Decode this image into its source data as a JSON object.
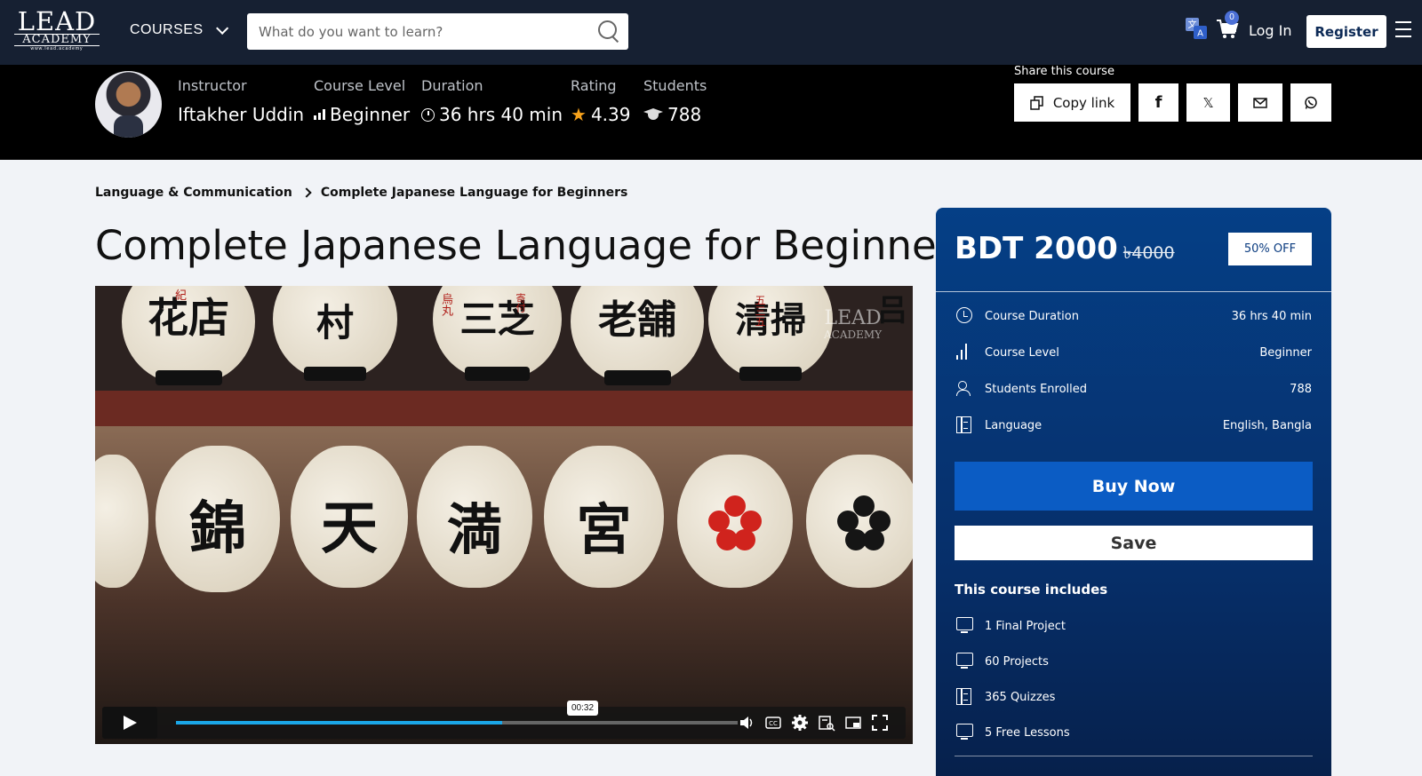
{
  "nav": {
    "logo": {
      "line1": "LEAD",
      "line2": "ACADEMY",
      "line3": "www.lead.academy"
    },
    "courses_label": "COURSES",
    "search_placeholder": "What do you want to learn?",
    "cart_count": "0",
    "login_label": "Log In",
    "register_label": "Register"
  },
  "course_meta": {
    "instructor_label": "Instructor",
    "instructor_name": "Iftakher Uddin",
    "level_label": "Course Level",
    "level_value": "Beginner",
    "duration_label": "Duration",
    "duration_value": "36 hrs 40 min",
    "rating_label": "Rating",
    "rating_value": "4.39",
    "students_label": "Students",
    "students_value": "788"
  },
  "share": {
    "title": "Share this course",
    "copy_label": "Copy link",
    "facebook": "f",
    "x": "𝕏"
  },
  "breadcrumb": {
    "category": "Language & Communication",
    "current": "Complete Japanese Language for Beginners"
  },
  "page_title": "Complete Japanese Language for Beginners",
  "video": {
    "tooltip_time": "00:32",
    "progress_fraction": 0.58,
    "watermark_line1": "LEAD",
    "watermark_line2": "ACADEMY",
    "lanterns_top": [
      "花店",
      "村",
      "三芝",
      "老舗",
      "清掃"
    ],
    "lanterns_top_extra": [
      "紀",
      "烏丸",
      "寄付",
      "五三五",
      "吕"
    ],
    "lanterns_mid": [
      "錦",
      "天",
      "満",
      "宮"
    ]
  },
  "pricing": {
    "price": "BDT 2000",
    "old_price": "৳4000",
    "discount_badge": "50% OFF"
  },
  "info": [
    {
      "icon": "clock-icon",
      "label": "Course Duration",
      "value": "36 hrs 40 min"
    },
    {
      "icon": "level-bars-icon",
      "label": "Course Level",
      "value": "Beginner"
    },
    {
      "icon": "users-icon",
      "label": "Students Enrolled",
      "value": "788"
    },
    {
      "icon": "document-icon",
      "label": "Language",
      "value": "English, Bangla"
    }
  ],
  "actions": {
    "buy_label": "Buy Now",
    "save_label": "Save"
  },
  "includes": {
    "title": "This course includes",
    "items": [
      {
        "icon": "monitor-icon",
        "label": "1 Final Project"
      },
      {
        "icon": "monitor-icon",
        "label": "60 Projects"
      },
      {
        "icon": "document-icon",
        "label": "365 Quizzes"
      },
      {
        "icon": "monitor-icon",
        "label": "5 Free Lessons"
      }
    ]
  },
  "colors": {
    "nav_bg": "#162032",
    "card_bg": "#053f86",
    "buy_bg": "#0b5cc4",
    "rating_star": "#f7a21b",
    "progress": "#1ba7e8"
  }
}
